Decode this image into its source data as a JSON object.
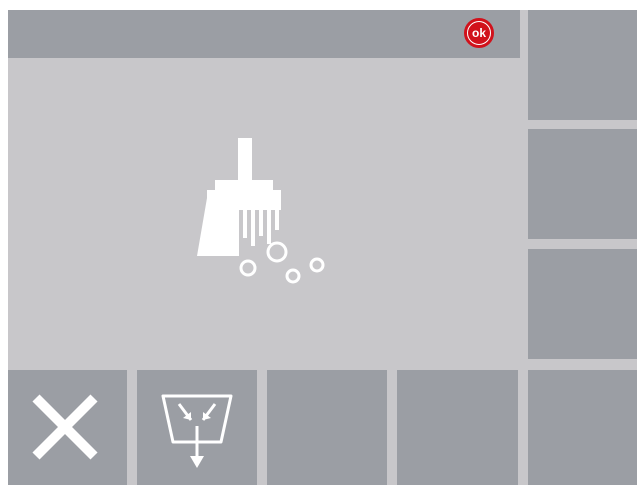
{
  "status": {
    "ok_label": "ok",
    "accent_color": "#d1111b"
  },
  "main": {
    "icon": "broom-icon"
  },
  "side_buttons": [
    {
      "icon": "",
      "label": ""
    },
    {
      "icon": "",
      "label": ""
    },
    {
      "icon": "",
      "label": ""
    }
  ],
  "bottom_buttons": [
    {
      "icon": "close-icon"
    },
    {
      "icon": "drain-icon"
    },
    {
      "icon": ""
    },
    {
      "icon": ""
    },
    {
      "icon": ""
    }
  ],
  "colors": {
    "tile": "#9b9ea4",
    "background": "#c8c7ca",
    "icon": "#ffffff"
  }
}
